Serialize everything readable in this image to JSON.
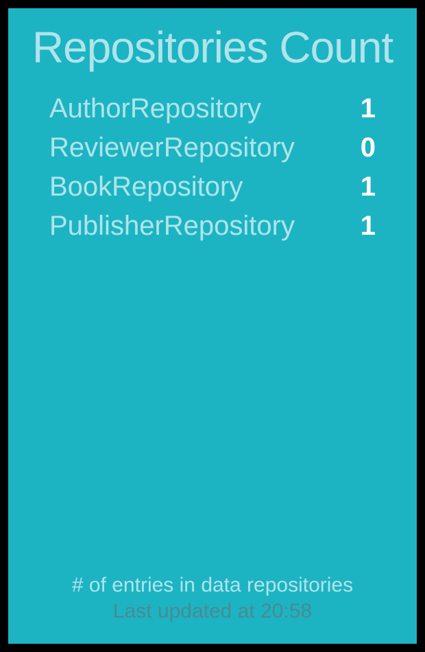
{
  "title": "Repositories Count",
  "rows": [
    {
      "label": "AuthorRepository",
      "value": "1"
    },
    {
      "label": "ReviewerRepository",
      "value": "0"
    },
    {
      "label": "BookRepository",
      "value": "1"
    },
    {
      "label": "PublisherRepository",
      "value": "1"
    }
  ],
  "subtitle": "# of entries in data repositories",
  "updated": "Last updated at 20:58"
}
